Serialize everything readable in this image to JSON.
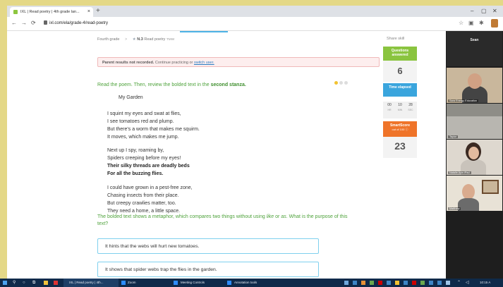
{
  "browser": {
    "tab_title": "IXL | Read poetry | 4th grade lan...",
    "tab_close": "×",
    "new_tab": "+",
    "url": "ixl.com/ela/grade-4/read-poetry",
    "window_controls": [
      "–",
      "▢",
      "✕"
    ]
  },
  "breadcrumb": {
    "grade": "Fourth grade",
    "skill_code": "N.3",
    "skill_name": "Read poetry",
    "skill_id": "TMW"
  },
  "share_skill": "Share skill",
  "notice": {
    "bold": "Parent results not recorded.",
    "text": "Continue practicing or",
    "link": "switch user."
  },
  "instruction": {
    "prefix": "Read the poem. Then, review the bolded text in the",
    "bold": "second stanza."
  },
  "poem": {
    "title": "My Garden",
    "stanza1": [
      "I squint my eyes and swat at flies,",
      "I see tomatoes red and plump.",
      "But there's a worm that makes me squirm.",
      "It moves, which makes me jump."
    ],
    "stanza2": [
      "Next up I spy, roaming by,",
      "Spiders creeping before my eyes!"
    ],
    "stanza2_bold": [
      "Their silky threads are deadly beds",
      "For all the buzzing flies."
    ],
    "stanza3": [
      "I could have grown in a pest-free zone,",
      "Chasing insects from their place.",
      "But creepy crawlies matter, too.",
      "They need a home, a little space."
    ]
  },
  "question": {
    "text": "The bolded text shows a metaphor, which compares two things without using like or as. What is the purpose of this text?"
  },
  "options": [
    "It hints that the webs will hurt new tomatoes.",
    "It shows that spider webs trap the flies in the garden."
  ],
  "stats": {
    "questions_label": "Questions answered",
    "questions_value": "6",
    "time_label": "Time elapsed",
    "time": [
      {
        "v": "00",
        "u": "HR"
      },
      {
        "v": "10",
        "u": "MIN"
      },
      {
        "v": "28",
        "u": "SEC"
      }
    ],
    "smartscore_label": "SmartScore",
    "smartscore_sub": "out of 100",
    "smartscore_value": "23"
  },
  "zoom": {
    "host_name": "Sean",
    "participants": [
      "Sara Energy Education",
      "Taylor",
      "Natalie Ayin iPad",
      "Matthew"
    ]
  },
  "taskbar": {
    "apps": [
      "IXL | Read poetry | 4th...",
      "Zoom",
      "Meeting Controls",
      "Annotation tools"
    ],
    "clock": "10:15 A"
  },
  "colors": {
    "green": "#8ac43f",
    "blue": "#3aa5dd",
    "orange": "#ef7429",
    "instruction_green": "#4ea23b"
  }
}
